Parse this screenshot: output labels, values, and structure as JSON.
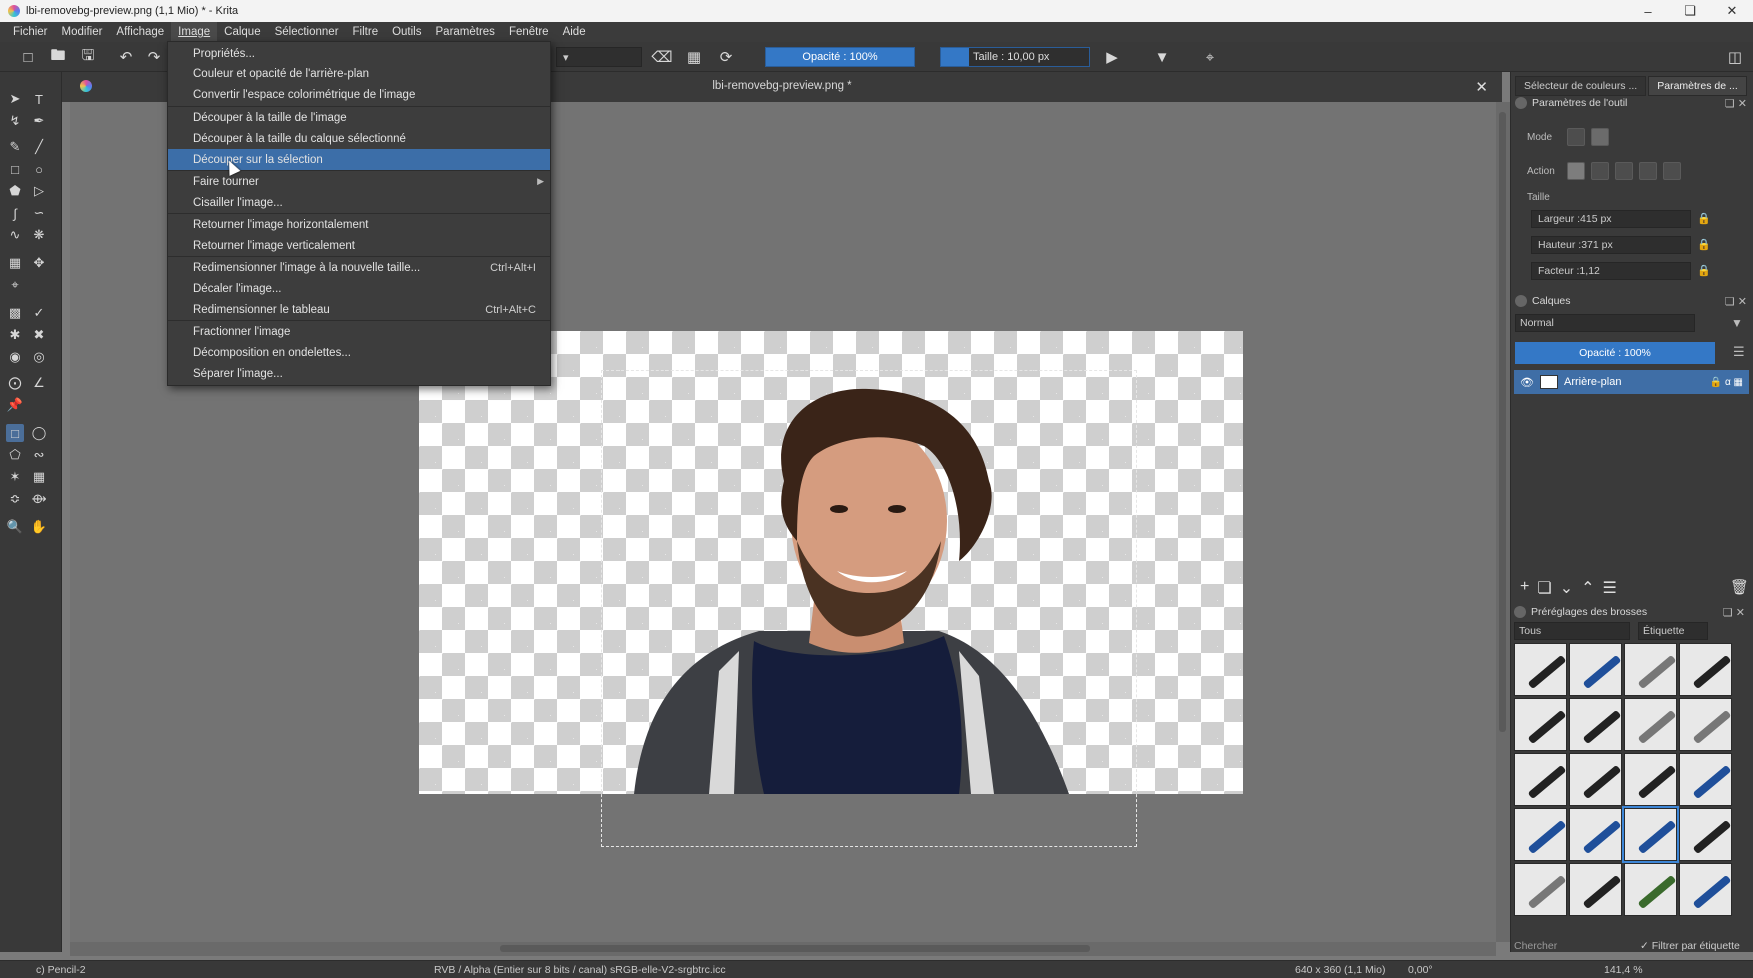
{
  "window": {
    "title": "lbi-removebg-preview.png (1,1 Mio)  * - Krita",
    "controls": [
      "minimize-icon",
      "maximize-icon",
      "close-icon"
    ]
  },
  "menubar": [
    "Fichier",
    "Modifier",
    "Affichage",
    "Image",
    "Calque",
    "Sélectionner",
    "Filtre",
    "Outils",
    "Paramètres",
    "Fenêtre",
    "Aide"
  ],
  "toolbar": {
    "opacity_label": "Opacité : 100%",
    "size_label": "Taille : 10,00 px"
  },
  "document": {
    "tab_title": "lbi-removebg-preview.png *"
  },
  "image_menu": {
    "items": [
      {
        "label": "Propriétés...",
        "shortcut": ""
      },
      {
        "label": "Couleur et opacité de l'arrière-plan",
        "shortcut": ""
      },
      {
        "label": "Convertir l'espace colorimétrique de l'image",
        "shortcut": ""
      },
      {
        "label": "Découper à la taille de l'image",
        "shortcut": ""
      },
      {
        "label": "Découper à la taille du calque sélectionné",
        "shortcut": ""
      },
      {
        "label": "Découper sur la sélection",
        "shortcut": "",
        "highlighted": true
      },
      {
        "label": "Faire tourner",
        "shortcut": "",
        "submenu": true
      },
      {
        "label": "Cisailler l'image...",
        "shortcut": ""
      },
      {
        "label": "Retourner l'image horizontalement",
        "shortcut": ""
      },
      {
        "label": "Retourner l'image verticalement",
        "shortcut": ""
      },
      {
        "label": "Redimensionner l'image à la nouvelle taille...",
        "shortcut": "Ctrl+Alt+I"
      },
      {
        "label": "Décaler l'image...",
        "shortcut": ""
      },
      {
        "label": "Redimensionner le tableau",
        "shortcut": "Ctrl+Alt+C"
      },
      {
        "label": "Fractionner l'image",
        "shortcut": ""
      },
      {
        "label": "Décomposition en ondelettes...",
        "shortcut": ""
      },
      {
        "label": "Séparer l'image...",
        "shortcut": ""
      }
    ]
  },
  "dock": {
    "tabs": [
      "Sélecteur de couleurs ...",
      "Paramètres de ..."
    ],
    "tool_options": {
      "title": "Paramètres de l'outil",
      "mode_label": "Mode",
      "action_label": "Action",
      "size_label": "Taille",
      "width": "Largeur :415 px",
      "height": "Hauteur :371 px",
      "ratio": "Facteur :1,12"
    },
    "layers": {
      "title": "Calques",
      "blend_mode": "Normal",
      "opacity": "Opacité : 100%",
      "layer_name": "Arrière-plan"
    },
    "brushes": {
      "title": "Préréglages des brosses",
      "filter_value": "Tous",
      "tag_label": "Étiquette",
      "search_placeholder": "Chercher",
      "filter_by_tag": "Filtrer par étiquette"
    }
  },
  "statusbar": {
    "brush": "c) Pencil-2",
    "color_info": "RVB / Alpha (Entier sur 8 bits / canal)  sRGB-elle-V2-srgbtrc.icc",
    "image_size": "640 x 360 (1,1 Mio)",
    "rotation": "0,00°",
    "zoom": "141,4 %"
  }
}
